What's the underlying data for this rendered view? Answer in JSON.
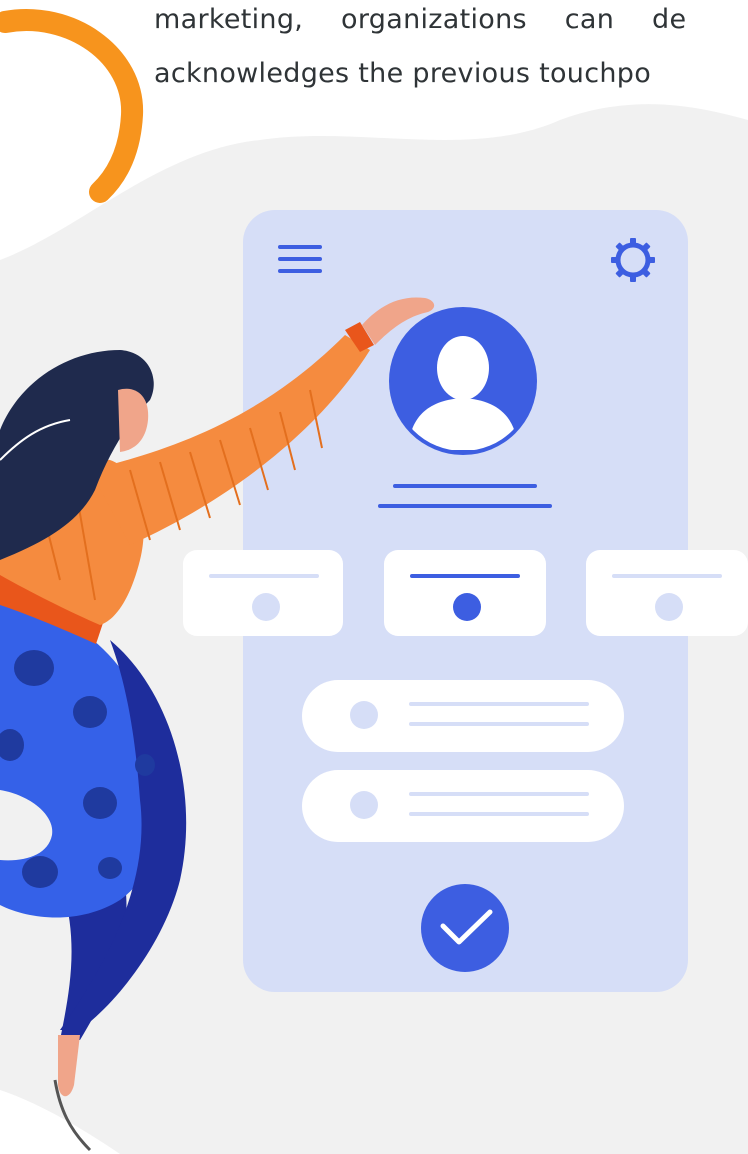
{
  "text": {
    "line1": "marketing, organizations can de",
    "line2": "acknowledges the previous touchpo"
  },
  "colors": {
    "accent_blue": "#3d5ee1",
    "phone_bg": "#d6def7",
    "blob_bg": "#f1f1f1",
    "arc_orange": "#f7941d",
    "sweater_orange": "#f58b3f",
    "skirt_blue": "#3561e8",
    "dark_hair": "#1f2a4d"
  },
  "icons": {
    "menu": "hamburger-menu-icon",
    "settings": "gear-icon",
    "avatar": "user-silhouette-icon",
    "confirm": "checkmark-icon"
  },
  "phone": {
    "cards_count": 3,
    "selected_card_index": 1,
    "list_items_count": 2
  }
}
